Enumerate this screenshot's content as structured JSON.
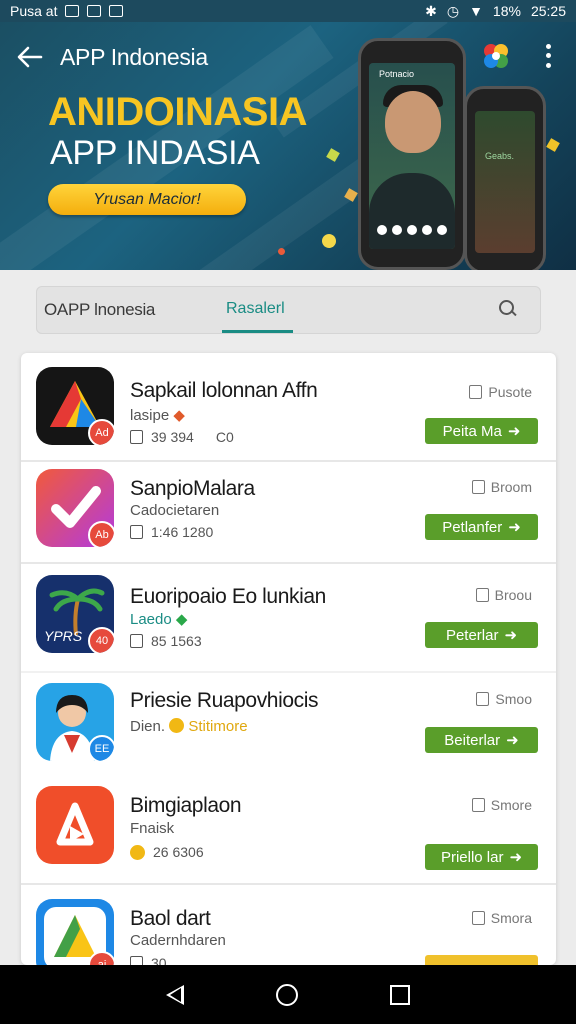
{
  "status_bar": {
    "carrier": "Pusa at",
    "battery": "18%",
    "time": "25:25"
  },
  "app_bar": {
    "title": "APP Indonesia"
  },
  "banner": {
    "headline_top": "ANIDOINASIA",
    "headline_bottom": "APP INDASIA",
    "cta_label": "Yrusan Macior!",
    "phone_label": "Potnacio",
    "phone2_label": "Geabs."
  },
  "search": {
    "placeholder": "OAPP lnonesia",
    "active_tab": "Rasalerl"
  },
  "apps": [
    {
      "name": "Sapkail lolonnan Affn",
      "sub": "lasipe",
      "meta": "39   394",
      "extra": "C0",
      "status": "Pusote",
      "button": "Peita Ma",
      "badge": "Ad",
      "badge_color": "#e64a3c"
    },
    {
      "name": "SanpioMalara",
      "sub": "Cadocietaren",
      "meta": "1:46   1280",
      "extra": "",
      "status": "Broom",
      "button": "Petlanfer",
      "badge": "Ab",
      "badge_color": "#e64a3c"
    },
    {
      "name": "Euoripoaio Eo lunkian",
      "sub": "Laedo",
      "meta": "85   1563",
      "extra": "",
      "status": "Broou",
      "button": "Peterlar",
      "badge": "40",
      "badge_color": "#e64a3c"
    },
    {
      "name": "Priesie Ruapovhiocis",
      "sub": "Dien.",
      "meta": "",
      "highlight": "Stitimore",
      "extra": "",
      "status": "Smoo",
      "button": "Beiterlar",
      "badge": "EE",
      "badge_color": "#1e88e5"
    },
    {
      "name": "Bimgiaplaon",
      "sub": "Fnaisk",
      "meta": "26   6306",
      "extra": "",
      "status": "Smore",
      "button": "Priello lar",
      "badge": "",
      "badge_color": ""
    },
    {
      "name": "Baol dart",
      "sub": "Cadernhdaren",
      "meta": "30",
      "extra": "",
      "status": "Smora",
      "button": "",
      "badge": "ai",
      "badge_color": "#e64a3c"
    }
  ]
}
